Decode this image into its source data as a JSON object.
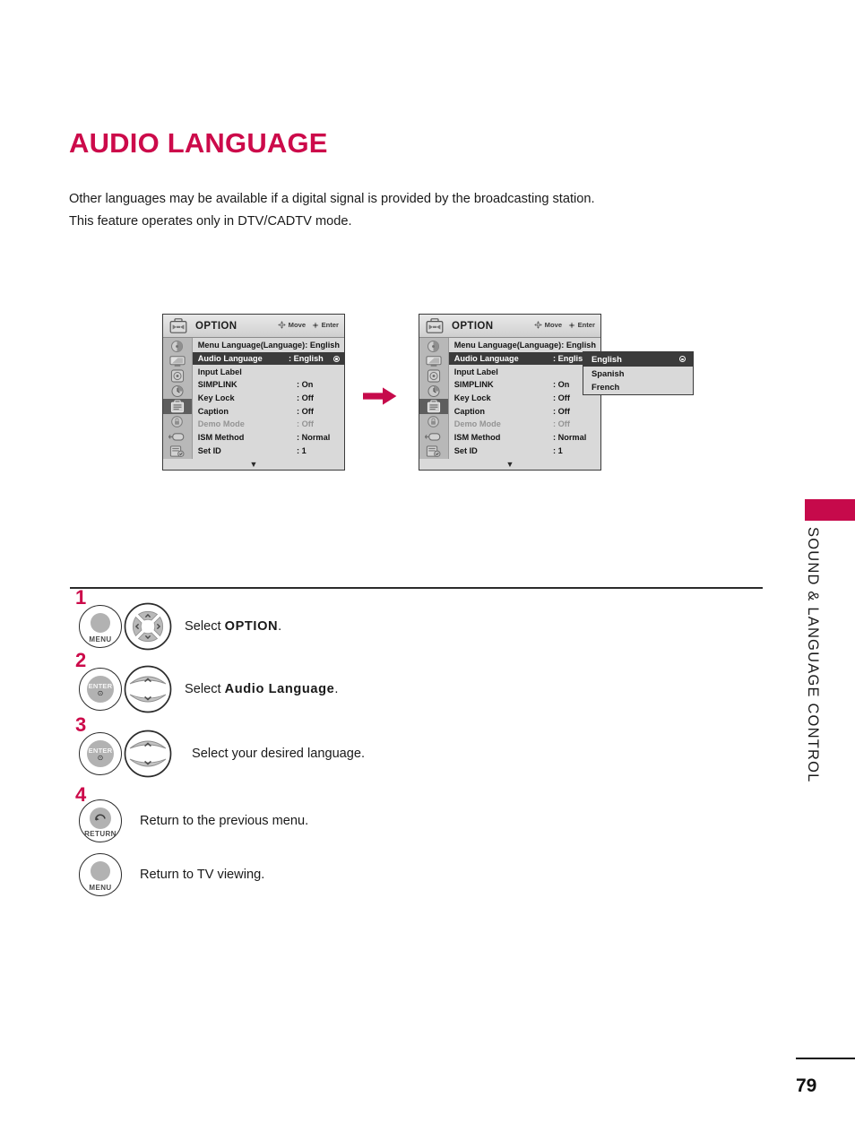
{
  "document": {
    "title": "AUDIO LANGUAGE",
    "intro_lines": [
      "Other languages may be available if a digital signal is provided by the broadcasting station.",
      "This feature operates only in DTV/CADTV mode."
    ],
    "side_label": "SOUND & LANGUAGE CONTROL",
    "page_number": "79",
    "accent_color": "#c60a4b",
    "title_color": "#cc0a4a"
  },
  "osd_before": {
    "header": {
      "title": "OPTION",
      "hint_move": "Move",
      "hint_enter": "Enter"
    },
    "rows": [
      {
        "label": "Menu Language(Language): English",
        "value": "",
        "state": "normal",
        "full": true
      },
      {
        "label": "Audio Language",
        "value": ": English",
        "state": "selected",
        "radio": true
      },
      {
        "label": "Input Label",
        "value": "",
        "state": "normal"
      },
      {
        "label": "SIMPLINK",
        "value": ": On",
        "state": "normal"
      },
      {
        "label": "Key Lock",
        "value": ": Off",
        "state": "normal"
      },
      {
        "label": "Caption",
        "value": ": Off",
        "state": "normal"
      },
      {
        "label": "Demo Mode",
        "value": ": Off",
        "state": "dim"
      },
      {
        "label": "ISM Method",
        "value": ": Normal",
        "state": "normal"
      },
      {
        "label": "Set ID",
        "value": ": 1",
        "state": "normal"
      }
    ],
    "scroll_caret": "▼"
  },
  "osd_after": {
    "header": {
      "title": "OPTION",
      "hint_move": "Move",
      "hint_enter": "Enter"
    },
    "rows": [
      {
        "label": "Menu Language(Language): English",
        "value": "",
        "state": "normal",
        "full": true
      },
      {
        "label": "Audio Language",
        "value": ": Englis",
        "state": "selected"
      },
      {
        "label": "Input Label",
        "value": "",
        "state": "normal"
      },
      {
        "label": "SIMPLINK",
        "value": ": On",
        "state": "normal"
      },
      {
        "label": "Key Lock",
        "value": ": Off",
        "state": "normal"
      },
      {
        "label": "Caption",
        "value": ": Off",
        "state": "normal"
      },
      {
        "label": "Demo Mode",
        "value": ": Off",
        "state": "dim"
      },
      {
        "label": "ISM Method",
        "value": ": Normal",
        "state": "normal"
      },
      {
        "label": "Set ID",
        "value": ": 1",
        "state": "normal"
      }
    ],
    "scroll_caret": "▼",
    "dropdown": {
      "options": [
        {
          "label": "English",
          "selected": true
        },
        {
          "label": "Spanish",
          "selected": false
        },
        {
          "label": "French",
          "selected": false
        }
      ]
    }
  },
  "steps": [
    {
      "number": "1",
      "button": {
        "kind": "menu",
        "caption": "MENU"
      },
      "pad": "dpad",
      "text_prefix": "Select ",
      "text_bold": "OPTION",
      "text_suffix": "."
    },
    {
      "number": "2",
      "button": {
        "kind": "enter",
        "caption": "",
        "label": "ENTER"
      },
      "pad": "updown",
      "text_prefix": "Select ",
      "text_bold": "Audio Language",
      "text_suffix": "."
    },
    {
      "number": "3",
      "button": {
        "kind": "enter",
        "caption": "",
        "label": "ENTER"
      },
      "pad": "updown",
      "text_prefix": "Select your desired language.",
      "text_bold": "",
      "text_suffix": ""
    },
    {
      "number": "4",
      "button": {
        "kind": "return",
        "caption": "RETURN"
      },
      "pad": "none",
      "text_prefix": "Return to the previous menu.",
      "text_bold": "",
      "text_suffix": ""
    },
    {
      "number": "",
      "button": {
        "kind": "menu",
        "caption": "MENU"
      },
      "pad": "none",
      "text_prefix": "Return to TV viewing.",
      "text_bold": "",
      "text_suffix": ""
    }
  ]
}
